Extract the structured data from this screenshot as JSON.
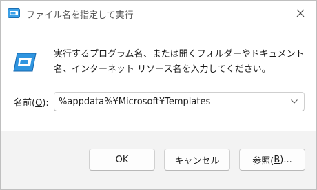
{
  "window": {
    "title": "ファイル名を指定して実行",
    "title_icon": "run-icon",
    "close_icon": "close-icon"
  },
  "main": {
    "app_icon": "run-app-icon",
    "description": "実行するプログラム名、または開くフォルダーやドキュメント名、インターネット リソース名を入力してください。",
    "open_label_prefix": "名前(",
    "open_label_accel": "O",
    "open_label_suffix": "):",
    "open_value": "%appdata%¥Microsoft¥Templates",
    "dropdown_icon": "chevron-down-icon"
  },
  "buttons": {
    "ok_label": "OK",
    "cancel_label": "キャンセル",
    "browse_prefix": "参照(",
    "browse_accel": "B",
    "browse_suffix": ")..."
  },
  "colors": {
    "accent": "#0078d4",
    "footer_bg": "#f3f3f3"
  }
}
